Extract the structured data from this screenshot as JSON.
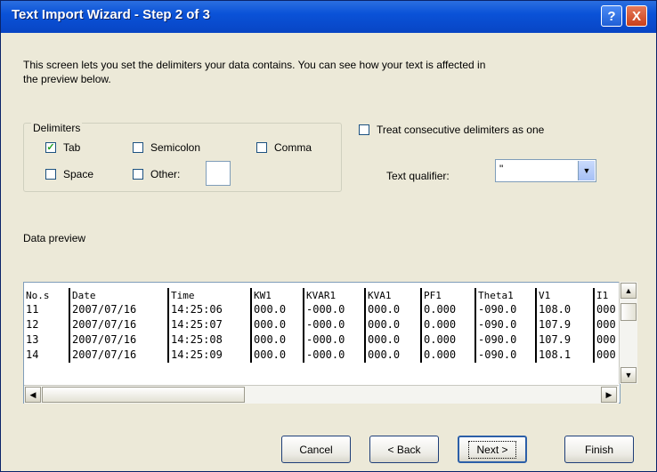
{
  "window": {
    "title": "Text Import Wizard - Step 2 of 3",
    "help_label": "?",
    "close_label": "X"
  },
  "intro_text": "This screen lets you set the delimiters your data contains.  You can see how your text is affected in the preview below.",
  "delimiters": {
    "legend": "Delimiters",
    "tab": {
      "label": "Tab",
      "checked": true
    },
    "semicolon": {
      "label": "Semicolon",
      "checked": false
    },
    "comma": {
      "label": "Comma",
      "checked": false
    },
    "space": {
      "label": "Space",
      "checked": false
    },
    "other": {
      "label": "Other:",
      "checked": false,
      "value": ""
    }
  },
  "consecutive": {
    "label": "Treat consecutive delimiters as one",
    "checked": false
  },
  "qualifier": {
    "label": "Text qualifier:",
    "value": "\""
  },
  "preview": {
    "label": "Data preview",
    "headers": [
      "No.s",
      "Date",
      "Time",
      "KW1",
      "KVAR1",
      "KVA1",
      "PF1",
      "Theta1",
      "V1",
      "I1"
    ],
    "rows": [
      [
        "11",
        "2007/07/16",
        "14:25:06",
        "000.0",
        "-000.0",
        "000.0",
        "0.000",
        "-090.0",
        "108.0",
        "000"
      ],
      [
        "12",
        "2007/07/16",
        "14:25:07",
        "000.0",
        "-000.0",
        "000.0",
        "0.000",
        "-090.0",
        "107.9",
        "000"
      ],
      [
        "13",
        "2007/07/16",
        "14:25:08",
        "000.0",
        "-000.0",
        "000.0",
        "0.000",
        "-090.0",
        "107.9",
        "000"
      ],
      [
        "14",
        "2007/07/16",
        "14:25:09",
        "000.0",
        "-000.0",
        "000.0",
        "0.000",
        "-090.0",
        "108.1",
        "000"
      ]
    ]
  },
  "buttons": {
    "cancel": "Cancel",
    "back": "< Back",
    "next": "Next >",
    "finish": "Finish"
  },
  "colors": {
    "titlebar": "#0a52d8",
    "dialog_bg": "#ece9d8",
    "checkmark": "#21a121"
  }
}
